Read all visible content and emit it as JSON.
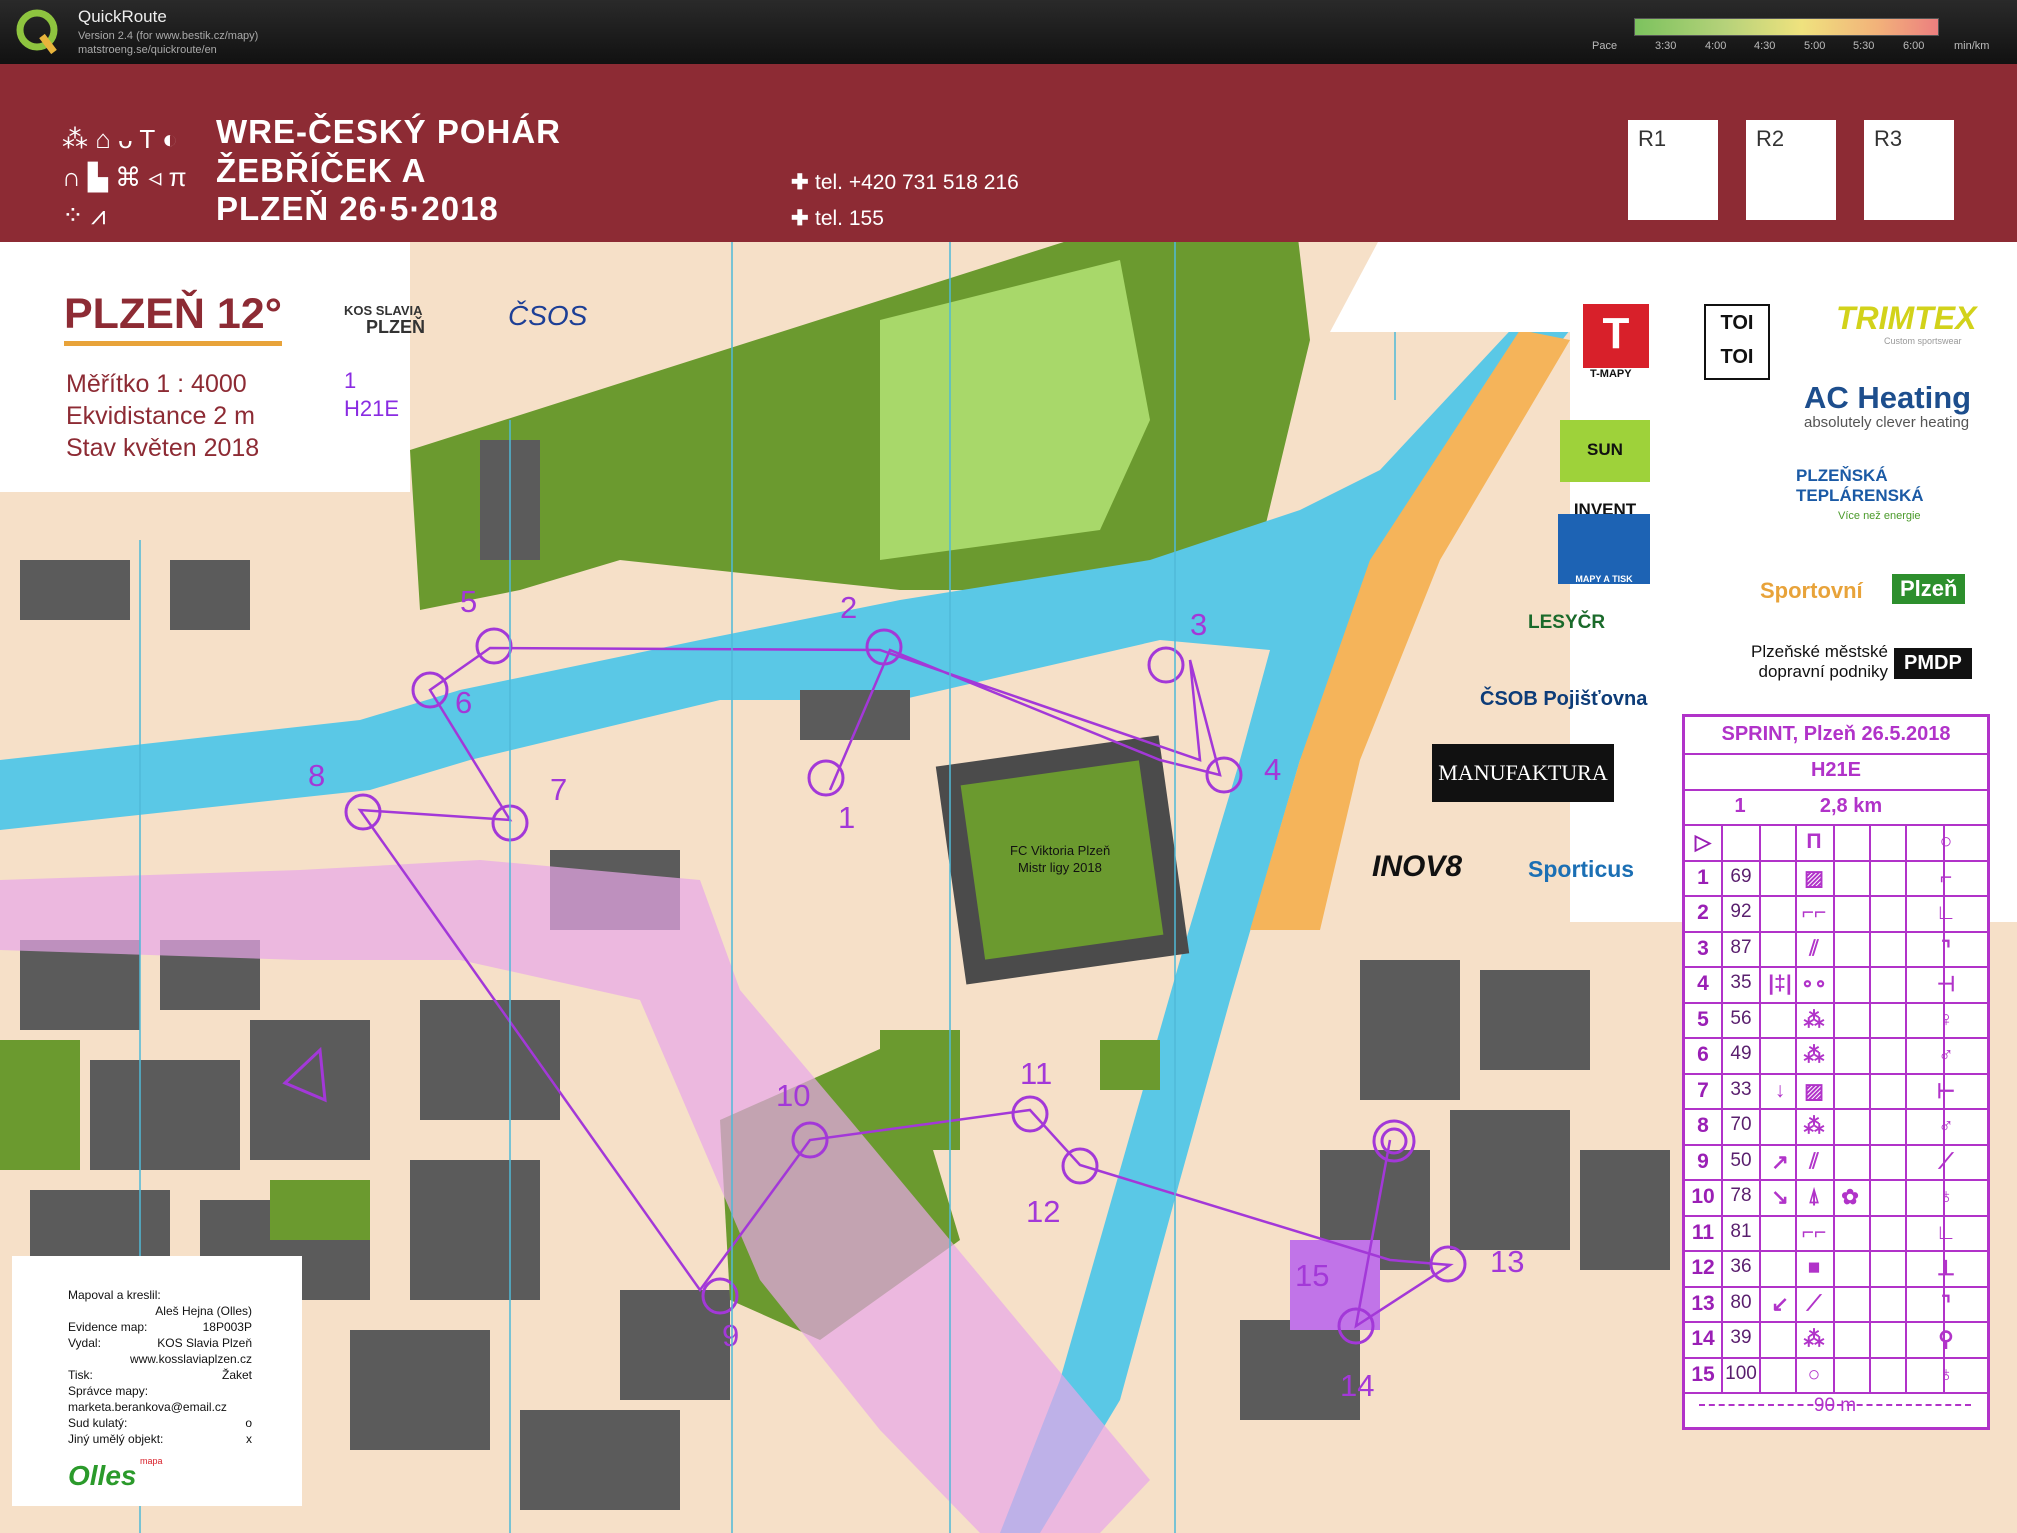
{
  "app": {
    "title": "QuickRoute",
    "version_line": "Version 2.4  (for www.bestik.cz/mapy)",
    "url": "matstroeng.se/quickroute/en",
    "pace_label": "Pace",
    "pace_ticks": [
      "3:30",
      "4:00",
      "4:30",
      "5:00",
      "5:30",
      "6:00"
    ],
    "pace_unit": "min/km"
  },
  "event": {
    "line1": "WRE-ČESKÝ POHÁR",
    "line2": "ŽEBŘÍČEK A",
    "line3": "PLZEŇ 26·5·2018",
    "symbols": "⁂ ⌂ ᴗ T ◐ ∩ ▙ ⌘ ◃ π ⁘ ⩘",
    "phone1": "tel. +420 731 518 216",
    "phone2": "tel. 155",
    "boxes": [
      "R1",
      "R2",
      "R3"
    ]
  },
  "map_info": {
    "title": "PLZEŇ 12°",
    "scale": "Měřítko    1 : 4000",
    "contour": "Ekvidistance 2 m",
    "state": "Stav květen 2018",
    "course_no": "1",
    "course_class": "H21E",
    "club_logo_top": "KOS SLAVIA",
    "club_logo_bottom": "PLZEŇ",
    "csos": "ČSOS"
  },
  "sponsors": {
    "tmapy": "T-MAPY",
    "toitoi": "TOI TOI",
    "trimtex": "TRIMTEX",
    "trimtex_sub": "Custom sportswear",
    "ac_heating": "AC Heating",
    "ac_heating_sub": "absolutely clever heating",
    "sun_invent": "SUN INVENT",
    "zakret": "MAPY A TISK",
    "teplarenska": "PLZEŇSKÁ TEPLÁRENSKÁ",
    "teplarenska_sub": "Více než energie",
    "sportovni": "Sportovní",
    "plzen": "Plzeň",
    "lesycr": "LESYČR",
    "pmdp_text": "Plzeňské městské dopravní podniky",
    "pmdp": "PMDP",
    "csob": "ČSOB Pojišťovna",
    "manufaktura": "MANUFAKTURA",
    "inov": "INOV8",
    "sporticus": "Sporticus"
  },
  "stadium": {
    "line1": "FC Viktoria Plzeň",
    "line2": "Mistr ligy 2018"
  },
  "credits": {
    "rows": [
      {
        "label": "Mapoval a kreslil:",
        "value": ""
      },
      {
        "label": "",
        "value": "Aleš Hejna (Olles)"
      },
      {
        "label": "Evidence map:",
        "value": "18P003P"
      },
      {
        "label": "Vydal:",
        "value": "KOS Slavia Plzeň"
      },
      {
        "label": "",
        "value": "www.kosslaviaplzen.cz"
      },
      {
        "label": "Tisk:",
        "value": "Žaket"
      },
      {
        "label": "Správce mapy:",
        "value": ""
      },
      {
        "label": "marketa.berankova@email.cz",
        "value": ""
      },
      {
        "label": "Sud kulatý:",
        "value": "o"
      },
      {
        "label": "Jiný umělý objekt:",
        "value": "x"
      }
    ],
    "olles": "Olles",
    "olles_small": "mapa"
  },
  "control_card": {
    "title": "SPRINT, Plzeň 26.5.2018",
    "course": "H21E",
    "course_no": "1",
    "length": "2,8 km",
    "start_symbol": "▷",
    "start_feature": "Π",
    "start_detail": "○",
    "footer": "90 m",
    "controls": [
      {
        "n": "1",
        "code": "69",
        "c": "",
        "d": "▨",
        "g": "⌐"
      },
      {
        "n": "2",
        "code": "92",
        "c": "",
        "d": "⌐⌐",
        "g": "∟"
      },
      {
        "n": "3",
        "code": "87",
        "c": "",
        "d": "⫽",
        "g": "⌝"
      },
      {
        "n": "4",
        "code": "35",
        "c": "|‡|",
        "d": "∘∘",
        "g": "⊣"
      },
      {
        "n": "5",
        "code": "56",
        "c": "",
        "d": "⁂",
        "g": "♀"
      },
      {
        "n": "6",
        "code": "49",
        "c": "",
        "d": "⁂",
        "g": "♂"
      },
      {
        "n": "7",
        "code": "33",
        "c": "↓",
        "d": "▨",
        "g": "⊢"
      },
      {
        "n": "8",
        "code": "70",
        "c": "",
        "d": "⁂",
        "g": "♂"
      },
      {
        "n": "9",
        "code": "50",
        "c": "↗",
        "d": "⫽",
        "g": "⟋"
      },
      {
        "n": "10",
        "code": "78",
        "c": "↘",
        "d": "⍋",
        "e": "✿",
        "g": "♁"
      },
      {
        "n": "11",
        "code": "81",
        "c": "",
        "d": "⌐⌐",
        "g": "∟"
      },
      {
        "n": "12",
        "code": "36",
        "c": "",
        "d": "■",
        "g": "⊥"
      },
      {
        "n": "13",
        "code": "80",
        "c": "↙",
        "d": "⟋",
        "g": "⌝"
      },
      {
        "n": "14",
        "code": "39",
        "c": "",
        "d": "⁂",
        "g": "⚲"
      },
      {
        "n": "15",
        "code": "100",
        "c": "",
        "d": "○",
        "g": "♁"
      }
    ]
  },
  "course_controls": [
    {
      "label": "1"
    },
    {
      "label": "2"
    },
    {
      "label": "3"
    },
    {
      "label": "4"
    },
    {
      "label": "5"
    },
    {
      "label": "6"
    },
    {
      "label": "7"
    },
    {
      "label": "8"
    },
    {
      "label": "9"
    },
    {
      "label": "10"
    },
    {
      "label": "11"
    },
    {
      "label": "12"
    },
    {
      "label": "13"
    },
    {
      "label": "14"
    },
    {
      "label": "15"
    }
  ],
  "colors": {
    "header": "#8d2b34",
    "water": "#5ac8e6",
    "forest": "#6b9a2f",
    "open": "#f5b45a",
    "building": "#5b5b5b",
    "course": "#a338d8",
    "paved": "#f6e0c8"
  }
}
